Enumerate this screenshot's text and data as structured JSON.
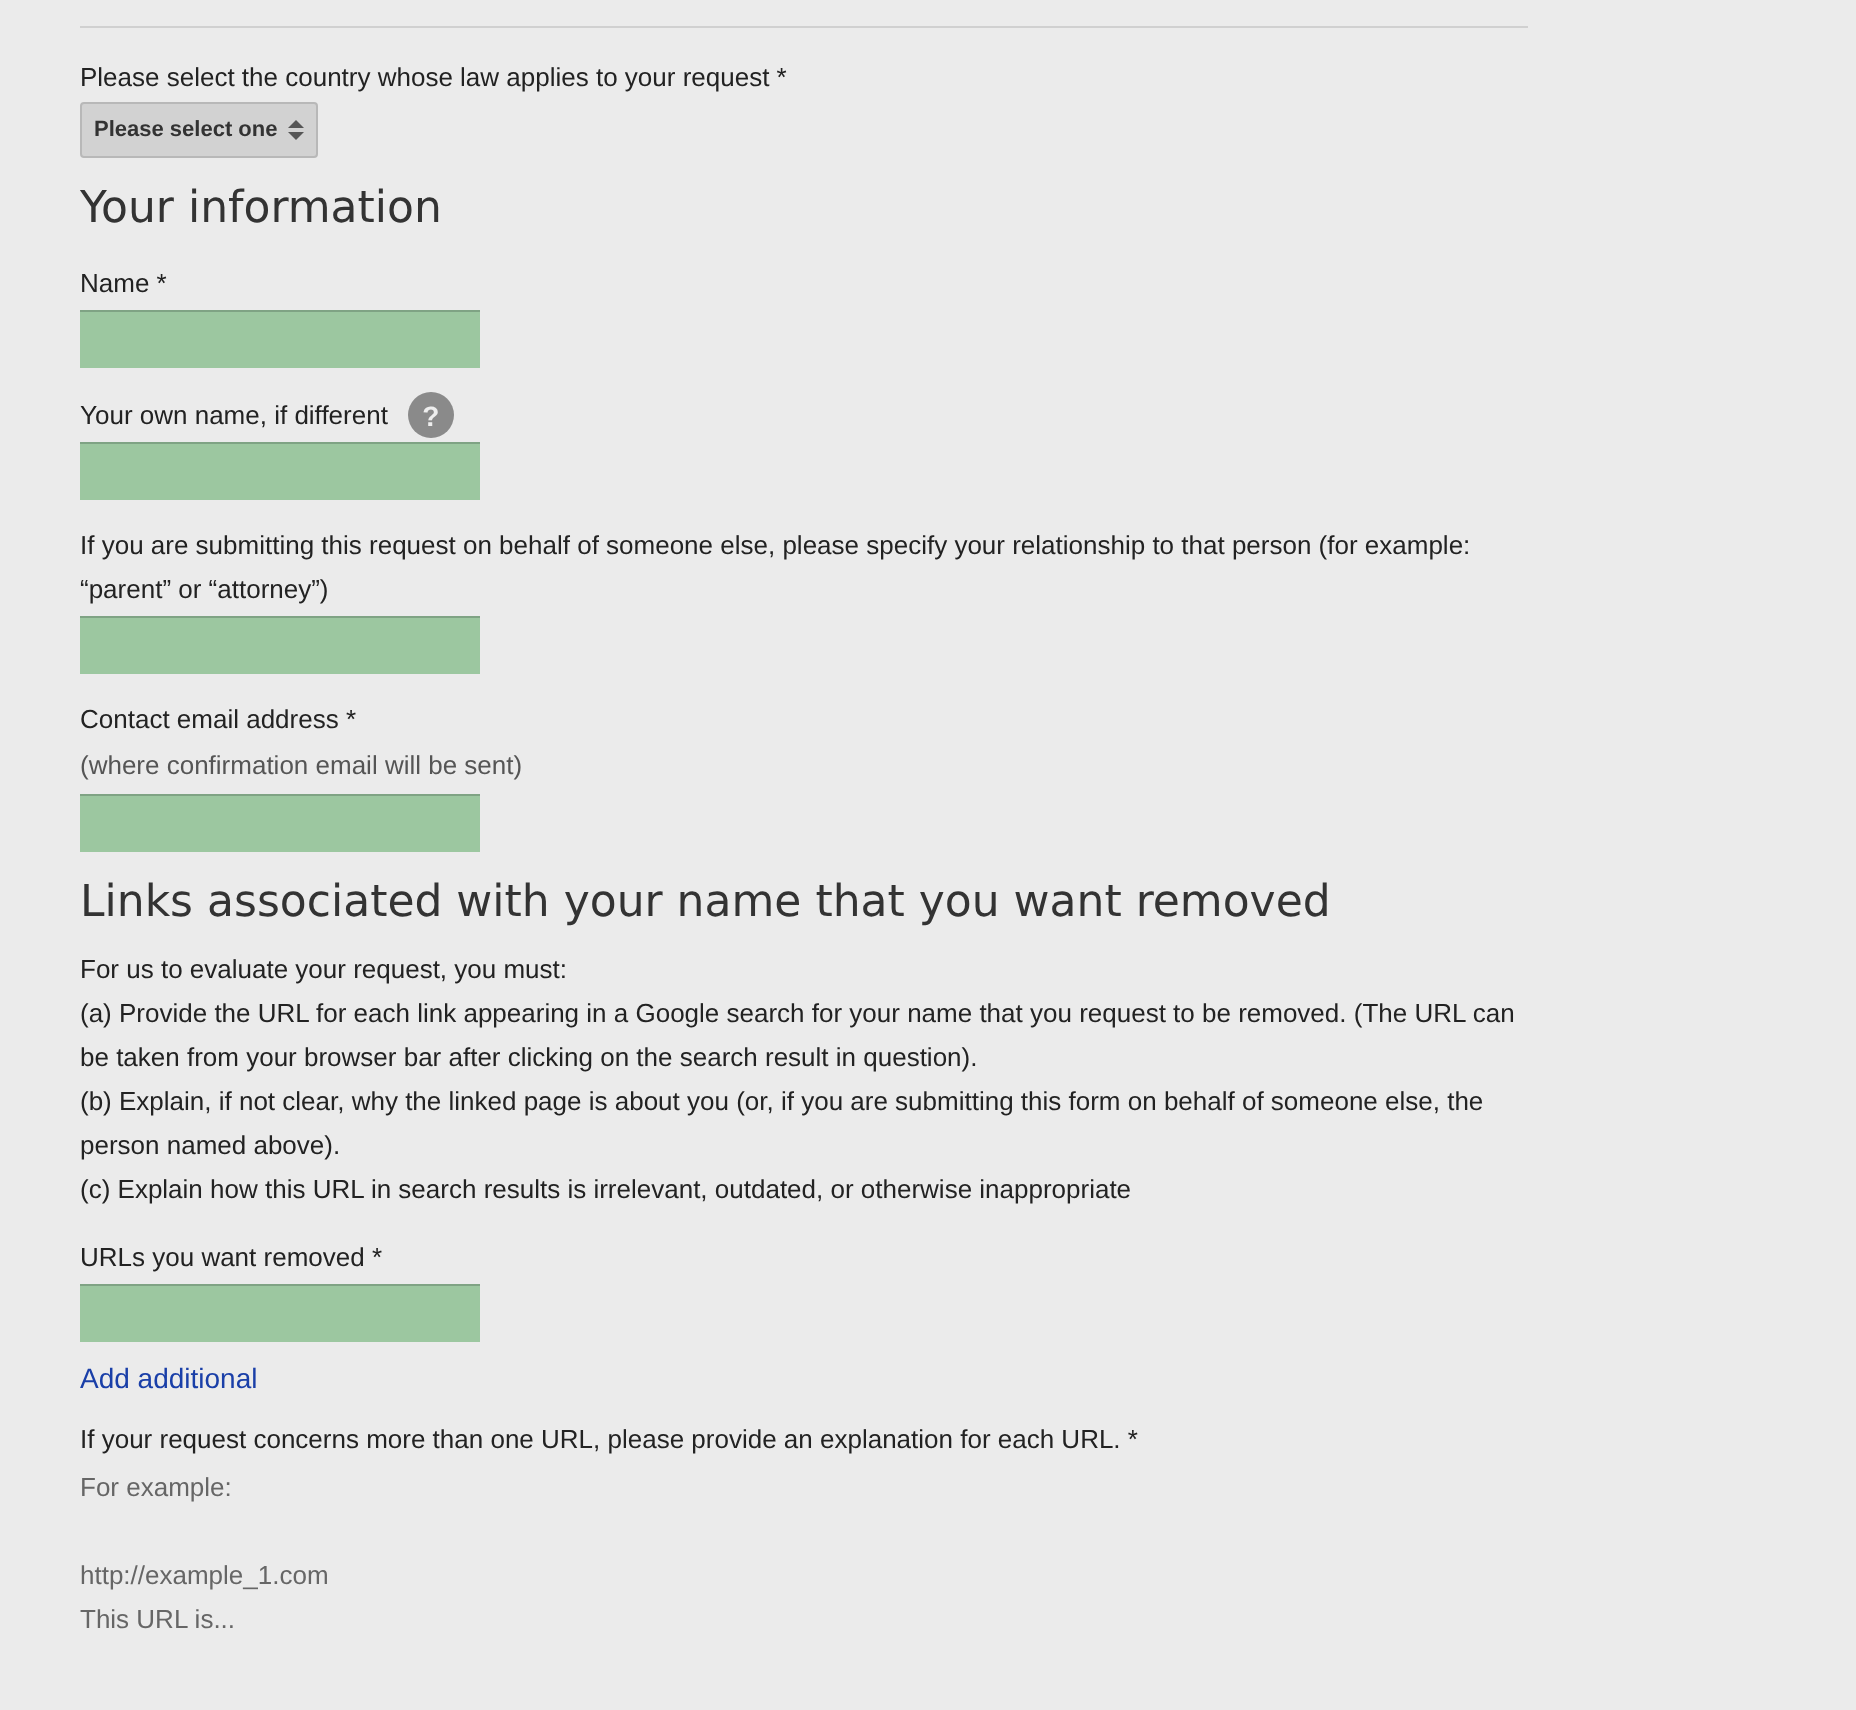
{
  "country": {
    "label": "Please select the country whose law applies to your request *",
    "select": "Please select one"
  },
  "sections": [
    {
      "heading": "Your information",
      "items": [
        {
          "kind": "input",
          "label": "Name *"
        },
        {
          "kind": "input",
          "label": "Your own name, if different",
          "help": "?"
        },
        {
          "kind": "input",
          "label": "If you are submitting this request on behalf of someone else, please specify your relationship to that person (for example: “parent” or “attorney”)"
        },
        {
          "kind": "input",
          "label": "Contact email address *",
          "hint": "(where confirmation email will be sent)"
        }
      ]
    },
    {
      "heading": "Links associated with your name that you want removed",
      "items": [
        {
          "kind": "text",
          "lines": [
            "For us to evaluate your request, you must:",
            "(a) Provide the URL for each link appearing in a Google search for your name that you request to be removed. (The URL can be taken from your browser bar after clicking on the search result in question).",
            "(b) Explain, if not clear, why the linked page is about you (or, if you are submitting this form on behalf of someone else, the person named above).",
            "(c) Explain how this URL in search results is irrelevant, outdated, or otherwise inappropriate"
          ]
        },
        {
          "kind": "input",
          "label": "URLs you want removed *"
        },
        {
          "kind": "link",
          "label": "Add additional"
        },
        {
          "kind": "textarea",
          "label": "If your request concerns more than one URL, please provide an explanation for each URL. *",
          "placeholder": "For example:\n\nhttp://example_1.com\nThis URL is..."
        }
      ]
    }
  ]
}
